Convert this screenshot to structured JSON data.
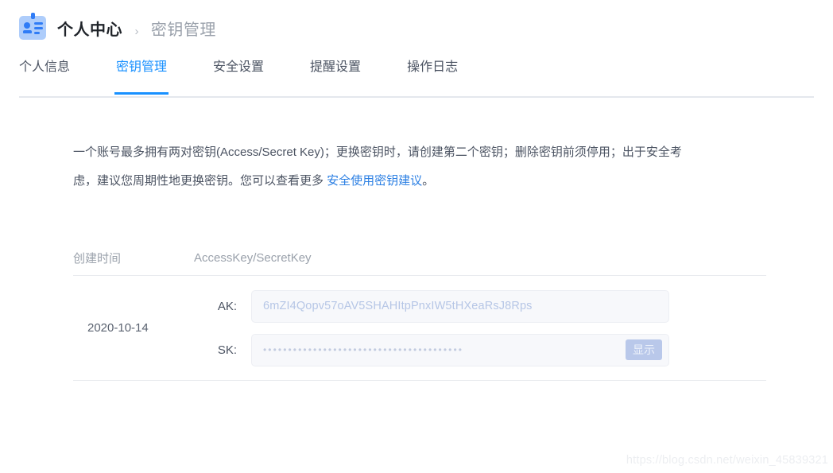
{
  "header": {
    "icon": "id-badge-icon",
    "breadcrumb": {
      "root": "个人中心",
      "separator": "›",
      "current": "密钥管理"
    }
  },
  "tabs": [
    {
      "label": "个人信息",
      "active": false
    },
    {
      "label": "密钥管理",
      "active": true
    },
    {
      "label": "安全设置",
      "active": false
    },
    {
      "label": "提醒设置",
      "active": false
    },
    {
      "label": "操作日志",
      "active": false
    }
  ],
  "description": {
    "part1": "一个账号最多拥有两对密钥(Access/Secret Key)；更换密钥时，请创建第二个密钥；删除密钥前须停用；出于安全考虑，建议您周期性地更换密钥。您可以查看更多 ",
    "link": "安全使用密钥建议",
    "part2": "。"
  },
  "table": {
    "columns": {
      "date": "创建时间",
      "keys": "AccessKey/SecretKey"
    },
    "rows": [
      {
        "date": "2020-10-14",
        "ak_label": "AK:",
        "ak_value": "6mZI4Qopv57oAV5SHAHItpPnxIW5tHXeaRsJ8Rps",
        "sk_label": "SK:",
        "sk_value": "••••••••••••••••••••••••••••••••••••••••",
        "sk_show_label": "显示"
      }
    ]
  },
  "watermark": "https://blog.csdn.net/weixin_45839321",
  "colors": {
    "accent": "#1890ff",
    "link": "#2b7fe3",
    "icon_bg": "#aecdfb",
    "icon_fg": "#2f7cf6",
    "field_bg": "#f7f8fb",
    "show_btn_bg": "#b9c8ea",
    "text": "#4b5362",
    "muted": "#9aa1ab"
  }
}
